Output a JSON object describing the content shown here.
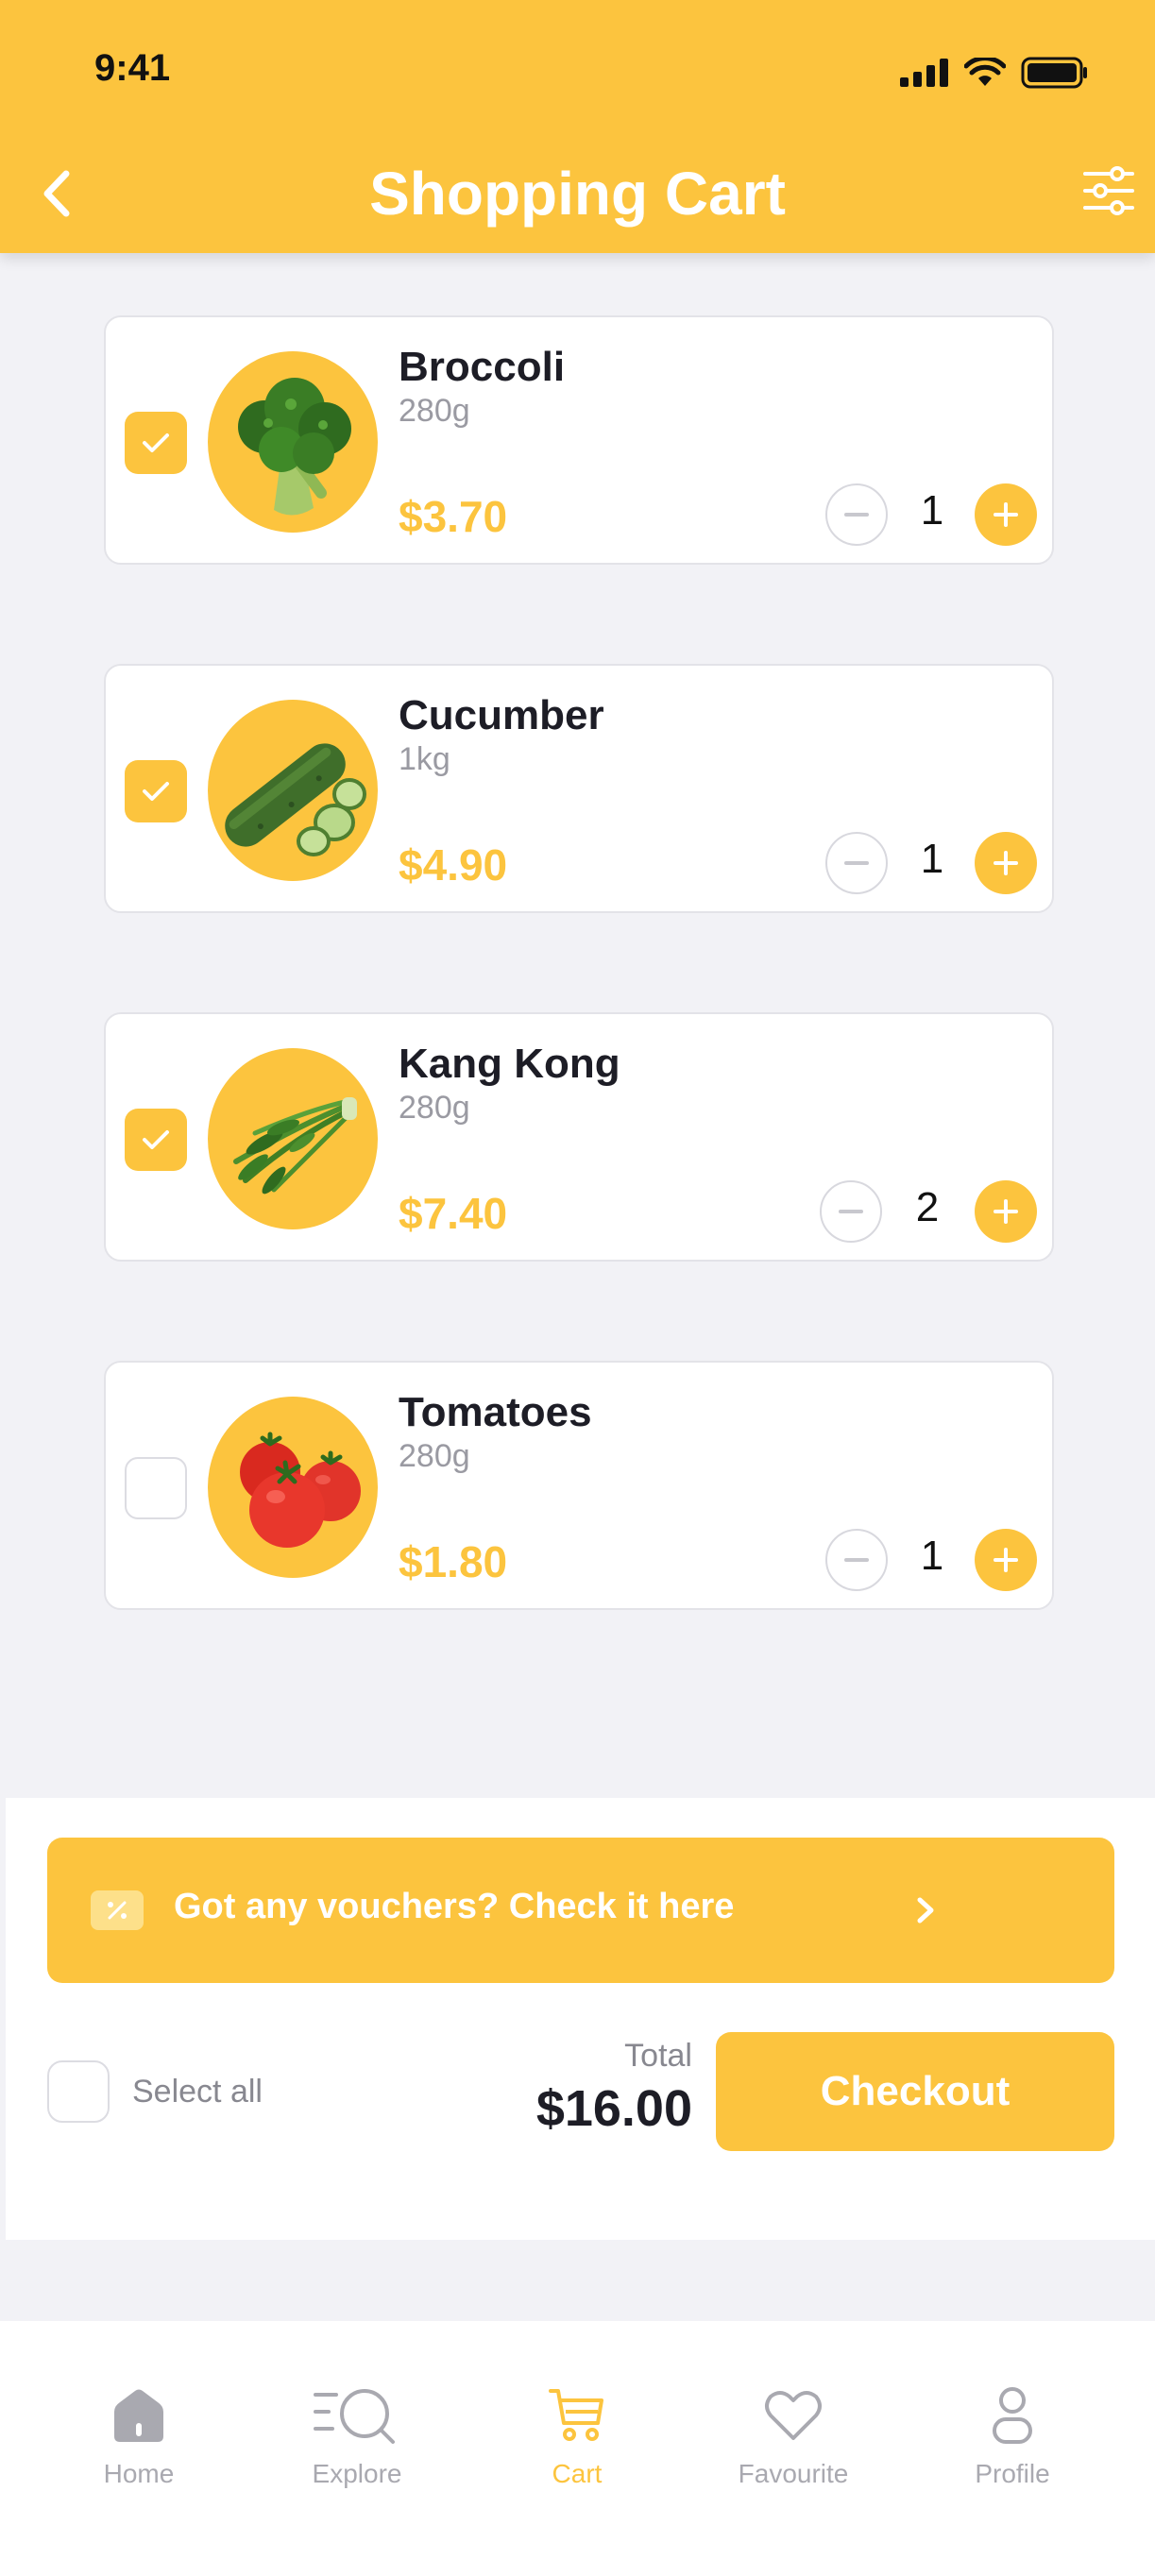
{
  "status_bar": {
    "time": "9:41"
  },
  "header": {
    "title": "Shopping Cart"
  },
  "cart": {
    "items": [
      {
        "name": "Broccoli",
        "weight": "280g",
        "price": "$3.70",
        "qty": "1",
        "checked": true
      },
      {
        "name": "Cucumber",
        "weight": "1kg",
        "price": "$4.90",
        "qty": "1",
        "checked": true
      },
      {
        "name": "Kang Kong",
        "weight": "280g",
        "price": "$7.40",
        "qty": "2",
        "checked": true
      },
      {
        "name": "Tomatoes",
        "weight": "280g",
        "price": "$1.80",
        "qty": "1",
        "checked": false
      }
    ]
  },
  "voucher": {
    "text": "Got any vouchers? Check it here"
  },
  "summary": {
    "select_all_label": "Select all",
    "total_label": "Total",
    "total_value": "$16.00",
    "checkout_label": "Checkout"
  },
  "tabbar": {
    "tabs": [
      {
        "label": "Home",
        "icon": "home-icon"
      },
      {
        "label": "Explore",
        "icon": "explore-icon"
      },
      {
        "label": "Cart",
        "icon": "cart-icon",
        "active": true
      },
      {
        "label": "Favourite",
        "icon": "heart-icon"
      },
      {
        "label": "Profile",
        "icon": "profile-icon"
      }
    ]
  },
  "colors": {
    "accent": "#fcc43e",
    "text_dark": "#1d1d26",
    "muted": "#9a9aa2",
    "background": "#f2f2f6"
  }
}
